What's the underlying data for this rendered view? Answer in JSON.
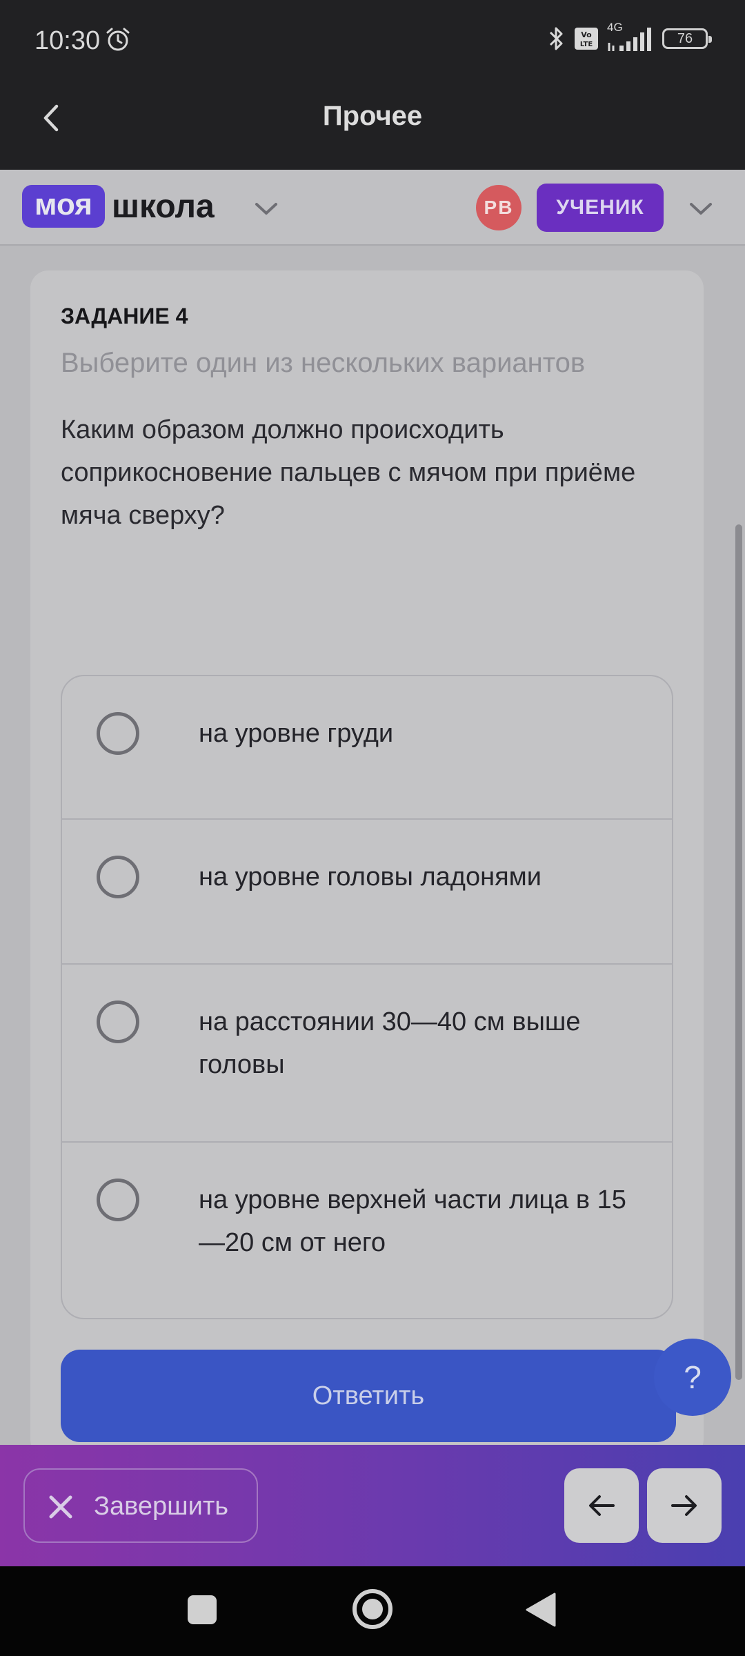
{
  "status_bar": {
    "time": "10:30",
    "network": "4G",
    "battery": "76"
  },
  "app_bar": {
    "title": "Прочее"
  },
  "school_header": {
    "logo_part1": "моя",
    "logo_part2": "школа",
    "avatar_initials": "РВ",
    "role_label": "УЧЕНИК"
  },
  "task": {
    "number_label": "ЗАДАНИЕ 4",
    "hint": "Выберите один из нескольких вариантов",
    "question": "Каким образом должно происходить соприкосновение пальцев с мячом при приёме мяча сверху?",
    "options": [
      {
        "label": "на уровне груди"
      },
      {
        "label": "на уровне головы ладонями"
      },
      {
        "label": "на расстоянии 30—40 см выше головы"
      },
      {
        "label": "на уровне верхней части лица в 15 —20 см от него"
      }
    ],
    "submit_label": "Ответить",
    "help_label": "?"
  },
  "action_bar": {
    "finish_label": "Завершить"
  },
  "colors": {
    "accent": "#3a55c4",
    "brand": "#5b3fd0",
    "role_badge": "#6a2fc0",
    "avatar": "#d55a5e"
  }
}
